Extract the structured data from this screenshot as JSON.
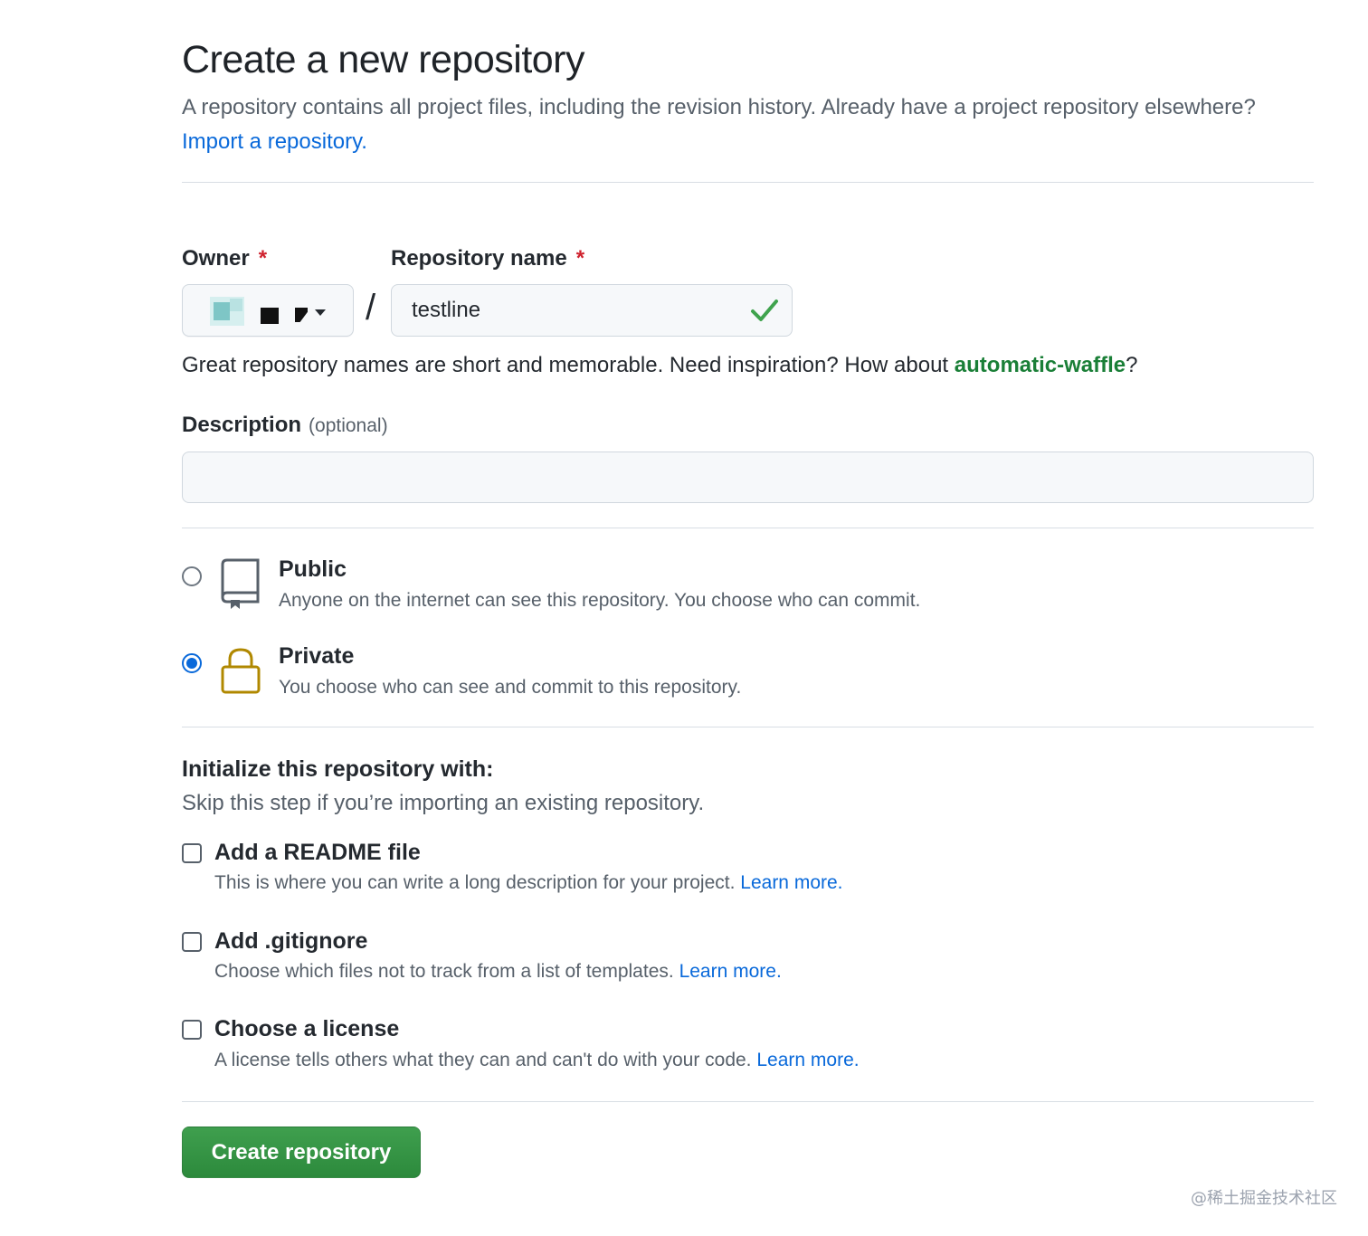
{
  "header": {
    "title": "Create a new repository",
    "subtitle": "A repository contains all project files, including the revision history. Already have a project repository elsewhere?",
    "import_link": "Import a repository."
  },
  "owner": {
    "label": "Owner",
    "required_mark": "*"
  },
  "repo_name": {
    "label": "Repository name",
    "required_mark": "*",
    "value": "testline",
    "hint_prefix": "Great repository names are short and memorable. Need inspiration? How about ",
    "suggestion": "automatic-waffle",
    "hint_suffix": "?"
  },
  "separator": "/",
  "description": {
    "label": "Description",
    "optional": "(optional)",
    "value": ""
  },
  "visibility": {
    "selected": "private",
    "public": {
      "title": "Public",
      "desc": "Anyone on the internet can see this repository. You choose who can commit."
    },
    "private": {
      "title": "Private",
      "desc": "You choose who can see and commit to this repository."
    }
  },
  "initialize": {
    "title": "Initialize this repository with:",
    "subtitle": "Skip this step if you’re importing an existing repository.",
    "options": [
      {
        "title": "Add a README file",
        "desc": "This is where you can write a long description for your project.",
        "link": "Learn more.",
        "checked": false
      },
      {
        "title": "Add .gitignore",
        "desc": "Choose which files not to track from a list of templates.",
        "link": "Learn more.",
        "checked": false
      },
      {
        "title": "Choose a license",
        "desc": "A license tells others what they can and can't do with your code.",
        "link": "Learn more.",
        "checked": false
      }
    ]
  },
  "submit": {
    "label": "Create repository"
  },
  "watermark": "@稀土掘金技术社区",
  "colors": {
    "link": "#0969da",
    "success": "#1a7f37",
    "danger": "#cf222e",
    "button": "#2da44e",
    "lock": "#b08800"
  }
}
